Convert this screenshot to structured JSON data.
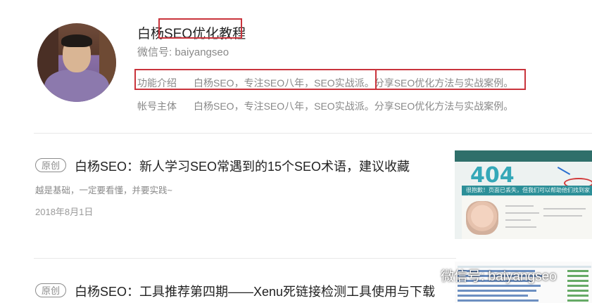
{
  "account": {
    "name_prefix": "白杨",
    "name_highlight": "SEO优化教程",
    "wechat_id": "微信号: baiyangseo",
    "func_label": "功能介绍",
    "func_text_a": "白杨SEO，专注SEO八年，SEO实战派。",
    "func_text_b": "分享SEO优化方法与实战案例。",
    "owner_label": "帐号主体",
    "owner_text": "白杨SEO，专注SEO八年，SEO实战派。分享SEO优化方法与实战案例。"
  },
  "articles": [
    {
      "badge": "原创",
      "title": "白杨SEO：新人学习SEO常遇到的15个SEO术语，建议收藏",
      "desc": "越是基础，一定要看懂，并要实践~",
      "date": "2018年8月1日",
      "thumb_big": "404",
      "thumb_band": "很抱歉！页面已丢失，但我们可以帮助他们找到家人..."
    },
    {
      "badge": "原创",
      "title": "白杨SEO：工具推荐第四期——Xenu死链接检测工具使用与下载"
    }
  ],
  "watermark": "微信号: baiyangseo",
  "colors": {
    "highlight_border": "#c9343c",
    "badge": "#8c8c8c",
    "thumb_accent": "#2c8f98"
  },
  "icons": [
    "wechat-watermark-icon"
  ]
}
